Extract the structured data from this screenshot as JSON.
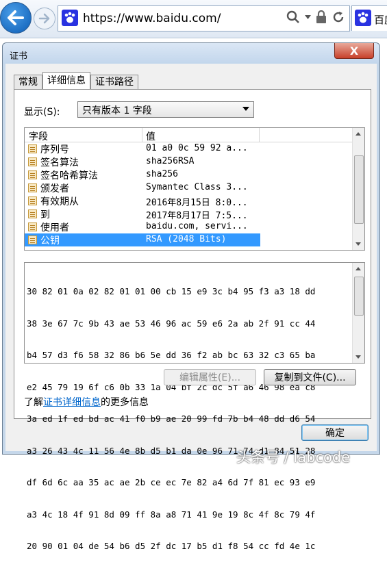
{
  "browser": {
    "url": "https://www.baidu.com/",
    "tab_title": "百度",
    "colors": {
      "back_button": "#1a6fc9",
      "favicon": "#2932e1"
    }
  },
  "dialog": {
    "title": "证书",
    "close_label": "X",
    "tabs": [
      "常规",
      "详细信息",
      "证书路径"
    ],
    "active_tab": "详细信息",
    "show_label": "显示(S):",
    "show_value": "只有版本 1 字段",
    "columns": [
      "字段",
      "值"
    ],
    "fields": [
      {
        "name": "序列号",
        "value": "01 a0 0c 59 92 a..."
      },
      {
        "name": "签名算法",
        "value": "sha256RSA"
      },
      {
        "name": "签名哈希算法",
        "value": "sha256"
      },
      {
        "name": "颁发者",
        "value": "Symantec Class 3..."
      },
      {
        "name": "有效期从",
        "value": "2016年8月15日 8:0..."
      },
      {
        "name": "到",
        "value": "2017年8月17日 7:5..."
      },
      {
        "name": "使用者",
        "value": "baidu.com, servi..."
      },
      {
        "name": "公钥",
        "value": "RSA (2048 Bits)"
      }
    ],
    "selected_field": "公钥",
    "hex_lines": [
      "30 82 01 0a 02 82 01 01 00 cb 15 e9 3c b4 95 f3 a3 18 dd",
      "38 3e 67 7c 9b 43 ae 53 46 96 ac 59 e6 2a ab 2f 91 cc 44",
      "b4 57 d3 f6 58 32 86 b6 5e dd 36 f2 ab bc 63 32 c3 65 ba",
      "e2 45 79 19 6f c6 0b 33 1a 04 bf 2c dc 5f a6 46 98 ea c8",
      "3a ed 1f ed bd ac 41 f0 b9 ae 20 99 fd 7b b4 48 dd d6 54",
      "a3 26 43 4c 11 56 4e 8b d5 b1 da 0e 96 71 74 d1 84 51 28",
      "df 6d 6c aa 35 ac ae 2b ce ec 7e 82 a4 6d 7f 81 ec 93 e9",
      "a3 4c 18 4f 91 8d 09 ff 8a a8 71 41 9e 19 8c 4f 8c 79 4f",
      "20 90 01 04 de 54 b6 d5 2f dc 17 b5 d1 f8 54 cc fd 4e 1c"
    ],
    "edit_properties_label": "编辑属性(E)...",
    "copy_to_file_label": "复制到文件(C)...",
    "learn_prefix": "了解",
    "learn_link": "证书详细信息",
    "learn_suffix": "的更多信息",
    "ok_label": "确定"
  },
  "watermark": "头条号 / labcode"
}
